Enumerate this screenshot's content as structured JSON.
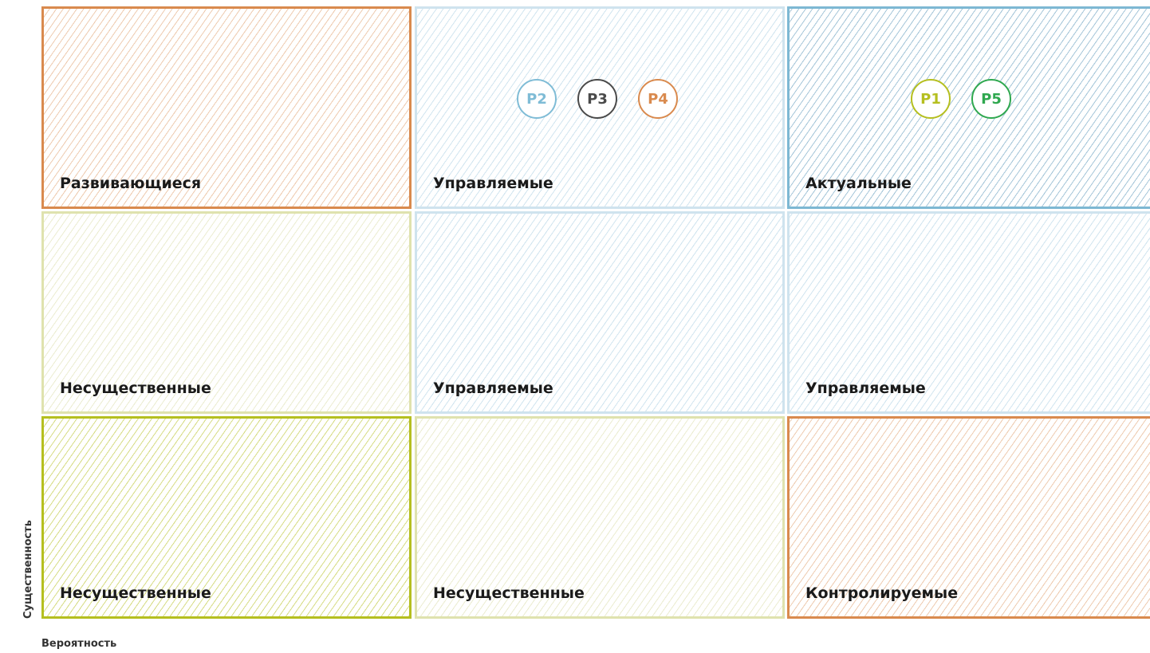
{
  "matrix": {
    "cells": [
      {
        "label": "Развивающиеся",
        "style": "orange",
        "border_color": "#d98a4e"
      },
      {
        "label": "Управляемые",
        "style": "lightblue",
        "border_color": "#cfe3ee"
      },
      {
        "label": "Актуальные",
        "style": "blue",
        "border_color": "#7db8d3"
      },
      {
        "label": "Несущественные",
        "style": "lightyellow",
        "border_color": "#dfe2ae"
      },
      {
        "label": "Управляемые",
        "style": "lightblue",
        "border_color": "#cfe3ee"
      },
      {
        "label": "Управляемые",
        "style": "lightblue",
        "border_color": "#cfe3ee"
      },
      {
        "label": "Несущественные",
        "style": "olive",
        "border_color": "#b5bf1f"
      },
      {
        "label": "Несущественные",
        "style": "lightyellow",
        "border_color": "#dfe2ae"
      },
      {
        "label": "Контролируемые",
        "style": "orange",
        "border_color": "#d98a4e"
      }
    ],
    "markers": [
      {
        "label": "P2",
        "color": "#7fbcd6",
        "cell": "top-middle"
      },
      {
        "label": "P3",
        "color": "#4a4a4a",
        "cell": "top-middle"
      },
      {
        "label": "P4",
        "color": "#d98a4e",
        "cell": "top-middle"
      },
      {
        "label": "P1",
        "color": "#b5bf1f",
        "cell": "top-right"
      },
      {
        "label": "P5",
        "color": "#2fa84f",
        "cell": "top-right"
      }
    ],
    "x_axis_label": "Вероятность",
    "y_axis_label": "Существенность"
  }
}
